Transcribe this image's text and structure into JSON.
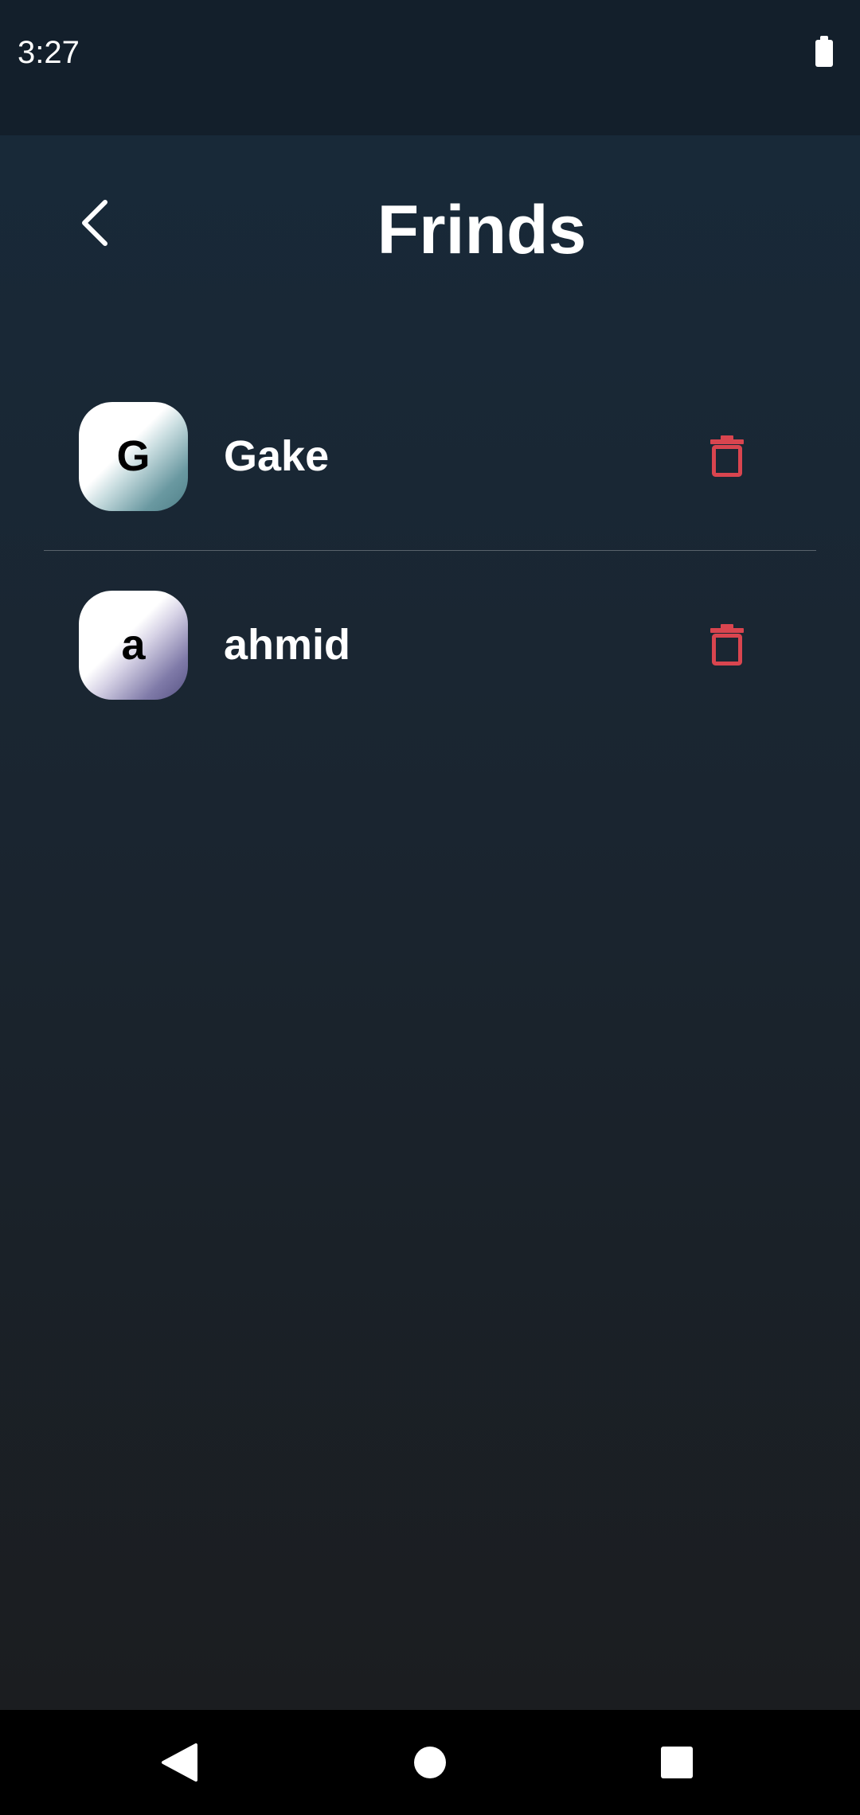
{
  "status_bar": {
    "time": "3:27",
    "battery_icon": "battery-full-icon"
  },
  "header": {
    "title": "Frinds",
    "back_icon": "chevron-left-icon"
  },
  "friends": [
    {
      "initial": "G",
      "name": "Gake",
      "delete_icon": "trash-icon"
    },
    {
      "initial": "a",
      "name": "ahmid",
      "delete_icon": "trash-icon"
    }
  ],
  "colors": {
    "delete_icon": "#d9454f",
    "background_top": "#182a3a",
    "background_bottom": "#1b1c1e",
    "status_bar": "#131f2b",
    "avatar_1_accent": "#4f7f88",
    "avatar_2_accent": "#565283"
  },
  "nav_bar": {
    "back_icon": "nav-back-triangle-icon",
    "home_icon": "nav-home-circle-icon",
    "recents_icon": "nav-recents-square-icon"
  }
}
